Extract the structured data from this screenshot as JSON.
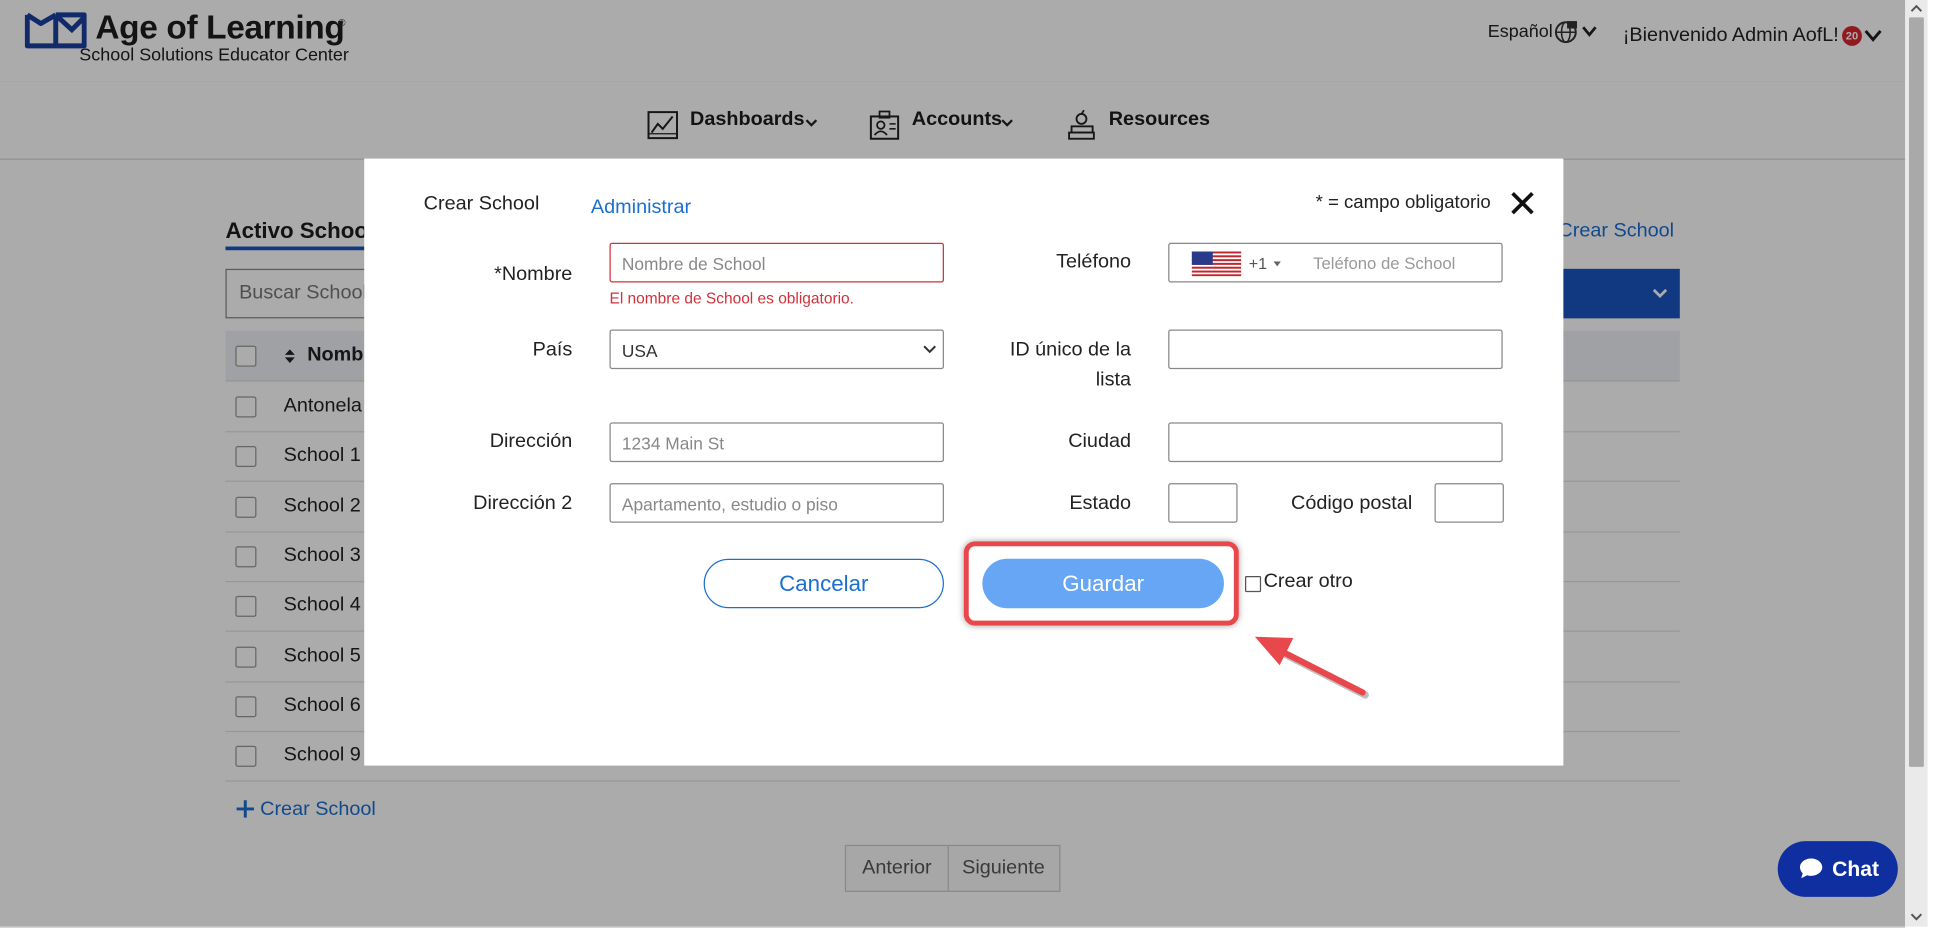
{
  "header": {
    "brand_name": "Age of Learning",
    "brand_reg": "®",
    "brand_sub": "School Solutions Educator Center",
    "language": "Español",
    "welcome": "¡Bienvenido Admin AofL!",
    "notification_count": "20"
  },
  "nav": {
    "items": [
      {
        "label": "Dashboards",
        "icon": "chart-icon"
      },
      {
        "label": "Accounts",
        "icon": "accounts-icon"
      },
      {
        "label": "Resources",
        "icon": "books-icon"
      }
    ]
  },
  "page": {
    "tab_active": "Activo Schoo",
    "top_create": "Crear School",
    "search_placeholder": "Buscar School",
    "column_name": "Nombr",
    "rows": [
      "Antonela",
      "School 1",
      "School 2",
      "School 3",
      "School 4",
      "School 5",
      "School 6",
      "School 9"
    ],
    "bottom_create": "Crear School",
    "pager_prev": "Anterior",
    "pager_next": "Siguiente"
  },
  "modal": {
    "title": "Crear School",
    "admin_link": "Administrar",
    "required_note": "* = campo obligatorio",
    "labels": {
      "name": "*Nombre",
      "phone": "Teléfono",
      "country": "País",
      "unique_id_line1": "ID único de la",
      "unique_id_line2": "lista",
      "address": "Dirección",
      "city": "Ciudad",
      "address2": "Dirección 2",
      "state": "Estado",
      "zip": "Código postal"
    },
    "name_placeholder": "Nombre de School",
    "name_error": "El nombre de School es obligatorio.",
    "phone_dial_code": "+1",
    "phone_placeholder": "Teléfono de School",
    "country_value": "USA",
    "address_placeholder": "1234 Main St",
    "address2_placeholder": "Apartamento, estudio o piso",
    "cancel_label": "Cancelar",
    "save_label": "Guardar",
    "create_other_label": "Crear otro"
  },
  "chat": {
    "label": "Chat"
  },
  "colors": {
    "primary_blue": "#1a56c2",
    "link_blue": "#1a6fd1",
    "save_button": "#66a6f5",
    "highlight_red": "#e8474b",
    "error_red": "#d0313a",
    "chat_navy": "#0f2fa0"
  }
}
